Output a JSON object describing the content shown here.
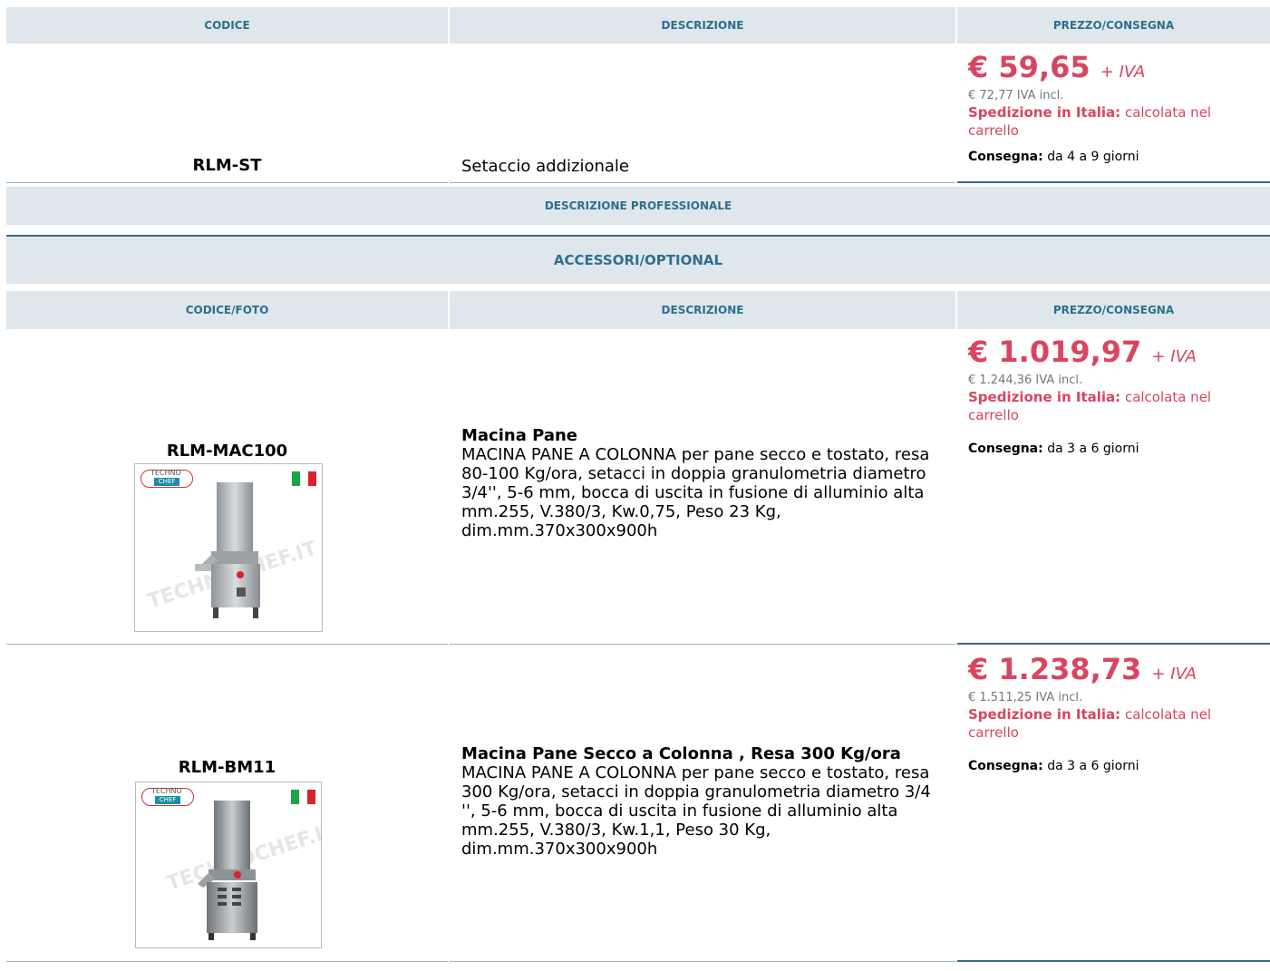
{
  "table1": {
    "headers": [
      "CODICE",
      "DESCRIZIONE",
      "PREZZO/CONSEGNA"
    ],
    "row": {
      "code": "RLM-ST",
      "description": "Setaccio addizionale",
      "price": "€ 59,65",
      "plus_iva": "+ IVA",
      "iva_incl": "€ 72,77 IVA incl.",
      "ship_label": "Spedizione in Italia:",
      "ship_text": "calcolata nel carrello",
      "delivery_label": "Consegna:",
      "delivery_text": "da 4 a 9 giorni"
    },
    "professional": "DESCRIZIONE PROFESSIONALE"
  },
  "accessories": {
    "title": "ACCESSORI/OPTIONAL",
    "headers": [
      "CODICE/FOTO",
      "DESCRIZIONE",
      "PREZZO/CONSEGNA"
    ],
    "items": [
      {
        "code": "RLM-MAC100",
        "title": "Macina Pane",
        "description": "MACINA PANE A COLONNA per pane secco e tostato, resa 80-100 Kg/ora, setacci in doppia granulometria diametro 3/4'', 5-6 mm, bocca di uscita in fusione di alluminio alta mm.255, V.380/3, Kw.0,75, Peso 23 Kg, dim.mm.370x300x900h",
        "price": "€ 1.019,97",
        "plus_iva": "+ IVA",
        "iva_incl": "€ 1.244,36 IVA incl.",
        "ship_label": "Spedizione in Italia:",
        "ship_text": "calcolata nel carrello",
        "delivery_label": "Consegna:",
        "delivery_text": "da 3 a 6 giorni",
        "logo_top": "TECHNO",
        "logo_bottom": "CHEF",
        "watermark": "TECHNOCHEF.IT"
      },
      {
        "code": "RLM-BM11",
        "title": "Macina Pane Secco a Colonna , Resa 300 Kg/ora",
        "description": "MACINA PANE A COLONNA per pane secco e tostato, resa 300 Kg/ora, setacci in doppia granulometria diametro 3/4 '', 5-6 mm, bocca di uscita in fusione di alluminio alta mm.255, V.380/3, Kw.1,1, Peso 30 Kg, dim.mm.370x300x900h",
        "price": "€ 1.238,73",
        "plus_iva": "+ IVA",
        "iva_incl": "€ 1.511,25 IVA incl.",
        "ship_label": "Spedizione in Italia:",
        "ship_text": "calcolata nel carrello",
        "delivery_label": "Consegna:",
        "delivery_text": "da 3 a 6 giorni",
        "logo_top": "TECHNO",
        "logo_bottom": "CHEF",
        "watermark": "TECHNOCHEF.IT"
      }
    ]
  },
  "colors": {
    "header_bg": "#dfe6ec",
    "header_text": "#2d6f8d",
    "price": "#d9455f",
    "rule": "#3a6a85"
  }
}
